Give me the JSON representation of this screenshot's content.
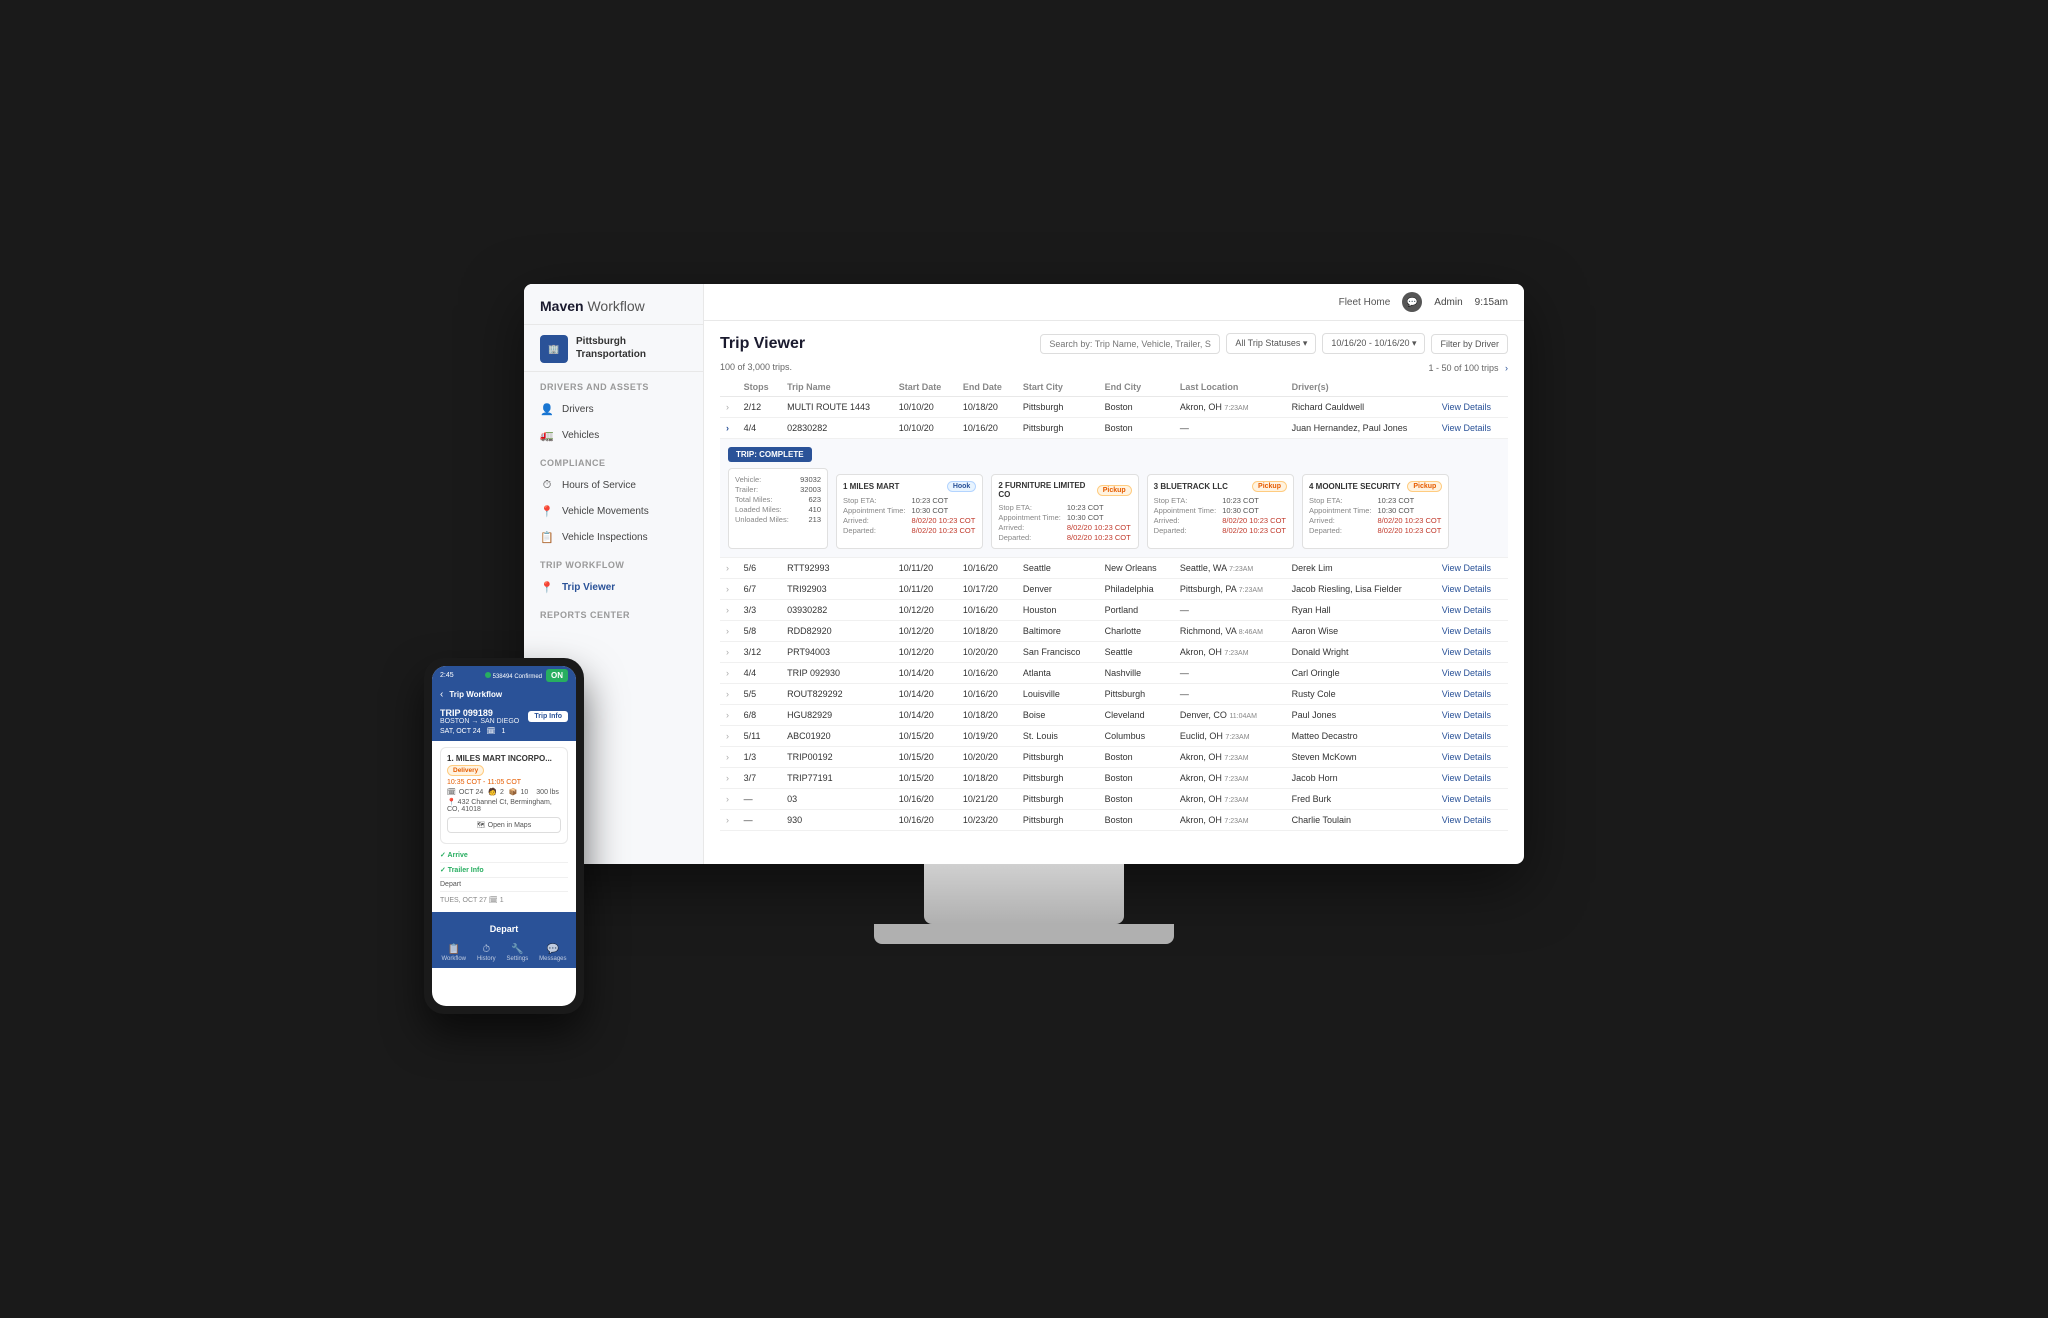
{
  "app": {
    "title": "Maven Workflow",
    "maven": "Maven",
    "workflow": "Workflow",
    "topbar": {
      "fleet_home": "Fleet Home",
      "admin": "Admin",
      "time": "9:15am"
    }
  },
  "sidebar": {
    "company": {
      "name": "Pittsburgh Transportation",
      "icon": "PT"
    },
    "sections": [
      {
        "title": "Drivers and Assets",
        "items": [
          {
            "label": "Drivers",
            "icon": "👤"
          },
          {
            "label": "Vehicles",
            "icon": "🚛"
          }
        ]
      },
      {
        "title": "Compliance",
        "items": [
          {
            "label": "Hours of Service",
            "icon": "⏱"
          },
          {
            "label": "Vehicle Movements",
            "icon": "📍"
          },
          {
            "label": "Vehicle Inspections",
            "icon": "📋"
          }
        ]
      },
      {
        "title": "Trip Workflow",
        "items": [
          {
            "label": "Trip Viewer",
            "icon": "📍",
            "active": true
          }
        ]
      },
      {
        "title": "Reports Center",
        "items": []
      }
    ]
  },
  "trip_viewer": {
    "title": "Trip Viewer",
    "search_placeholder": "Search by: Trip Name, Vehicle, Trailer, Stop Name",
    "status_filter": "All Trip Statuses ▾",
    "date_filter": "10/16/20 - 10/16/20 ▾",
    "driver_filter": "Filter by Driver",
    "total_count": "100 of 3,000 trips.",
    "pagination": "1 - 50 of 100 trips",
    "columns": [
      "Stops",
      "Trip Name",
      "Start Date",
      "End Date",
      "Start City",
      "End City",
      "Last Location",
      "Driver(s)",
      ""
    ],
    "expanded_row": {
      "badge": "TRIP: COMPLETE",
      "vehicle_info": {
        "vehicle": "93032",
        "trailer": "32003",
        "total_miles": "623",
        "loaded_miles": "410",
        "unloaded_miles": "213"
      },
      "stops": [
        {
          "number": "1",
          "name": "MILES MART",
          "badge": "Hook",
          "badge_type": "hook",
          "eta_label": "Stop ETA:",
          "eta_time": "10:23 COT",
          "apt_label": "Appointment Time:",
          "apt_time": "10:30 COT",
          "arrived_label": "Arrived:",
          "arrived_time": "8/02/20 10:23 COT",
          "departed_label": "Departed:",
          "departed_time": "8/02/20 10:23 COT"
        },
        {
          "number": "2",
          "name": "FURNITURE LIMITED CO",
          "badge": "Pickup",
          "badge_type": "pickup",
          "eta_label": "Stop ETA:",
          "eta_time": "10:23 COT",
          "apt_label": "Appointment Time:",
          "apt_time": "10:30 COT",
          "arrived_label": "Arrived:",
          "arrived_time": "8/02/20 10:23 COT",
          "departed_label": "Departed:",
          "departed_time": "8/02/20 10:23 COT"
        },
        {
          "number": "3",
          "name": "BLUETRACK LLC",
          "badge": "Pickup",
          "badge_type": "pickup",
          "eta_label": "Stop ETA:",
          "eta_time": "10:23 COT",
          "apt_label": "Appointment Time:",
          "apt_time": "10:30 COT",
          "arrived_label": "Arrived:",
          "arrived_time": "8/02/20 10:23 COT",
          "departed_label": "Departed:",
          "departed_time": "8/02/20 10:23 COT"
        },
        {
          "number": "4",
          "name": "MOONLITE SECURITY",
          "badge": "Pickup",
          "badge_type": "pickup",
          "eta_label": "Stop ETA:",
          "eta_time": "10:23 COT",
          "apt_label": "Appointment Time:",
          "apt_time": "10:30 COT",
          "arrived_label": "Arrived:",
          "arrived_time": "8/02/20 10:23 COT",
          "departed_label": "Departed:",
          "departed_time": "8/02/20 10:23 COT"
        }
      ]
    },
    "rows": [
      {
        "stops": "2/12",
        "trip": "MULTI ROUTE 1443",
        "start": "10/10/20",
        "end": "10/18/20",
        "start_city": "Pittsburgh",
        "end_city": "Boston",
        "last_loc": "Akron, OH",
        "last_time": "7:23AM",
        "drivers": "Richard Cauldwell"
      },
      {
        "stops": "4/4",
        "trip": "02830282",
        "start": "10/10/20",
        "end": "10/16/20",
        "start_city": "Pittsburgh",
        "end_city": "Boston",
        "last_loc": "—",
        "last_time": "",
        "drivers": "Juan Hernandez, Paul Jones"
      },
      {
        "stops": "5/6",
        "trip": "RTT92993",
        "start": "10/11/20",
        "end": "10/16/20",
        "start_city": "Seattle",
        "end_city": "New Orleans",
        "last_loc": "Seattle, WA",
        "last_time": "7:23AM",
        "drivers": "Derek Lim"
      },
      {
        "stops": "6/7",
        "trip": "TRI92903",
        "start": "10/11/20",
        "end": "10/17/20",
        "start_city": "Denver",
        "end_city": "Philadelphia",
        "last_loc": "Pittsburgh, PA",
        "last_time": "7:23AM",
        "drivers": "Jacob Riesling, Lisa Fielder"
      },
      {
        "stops": "3/3",
        "trip": "03930282",
        "start": "10/12/20",
        "end": "10/16/20",
        "start_city": "Houston",
        "end_city": "Portland",
        "last_loc": "—",
        "last_time": "",
        "drivers": "Ryan Hall"
      },
      {
        "stops": "5/8",
        "trip": "RDD82920",
        "start": "10/12/20",
        "end": "10/18/20",
        "start_city": "Baltimore",
        "end_city": "Charlotte",
        "last_loc": "Richmond, VA",
        "last_time": "8:46AM",
        "drivers": "Aaron Wise"
      },
      {
        "stops": "3/12",
        "trip": "PRT94003",
        "start": "10/12/20",
        "end": "10/20/20",
        "start_city": "San Francisco",
        "end_city": "Seattle",
        "last_loc": "Akron, OH",
        "last_time": "7:23AM",
        "drivers": "Donald Wright"
      },
      {
        "stops": "4/4",
        "trip": "TRIP 092930",
        "start": "10/14/20",
        "end": "10/16/20",
        "start_city": "Atlanta",
        "end_city": "Nashville",
        "last_loc": "—",
        "last_time": "",
        "drivers": "Carl Oringle"
      },
      {
        "stops": "5/5",
        "trip": "ROUT829292",
        "start": "10/14/20",
        "end": "10/16/20",
        "start_city": "Louisville",
        "end_city": "Pittsburgh",
        "last_loc": "—",
        "last_time": "",
        "drivers": "Rusty Cole"
      },
      {
        "stops": "6/8",
        "trip": "HGU82929",
        "start": "10/14/20",
        "end": "10/18/20",
        "start_city": "Boise",
        "end_city": "Cleveland",
        "last_loc": "Denver, CO",
        "last_time": "11:04AM",
        "drivers": "Paul Jones"
      },
      {
        "stops": "5/11",
        "trip": "ABC01920",
        "start": "10/15/20",
        "end": "10/19/20",
        "start_city": "St. Louis",
        "end_city": "Columbus",
        "last_loc": "Euclid, OH",
        "last_time": "7:23AM",
        "drivers": "Matteo Decastro"
      },
      {
        "stops": "1/3",
        "trip": "TRIP00192",
        "start": "10/15/20",
        "end": "10/20/20",
        "start_city": "Pittsburgh",
        "end_city": "Boston",
        "last_loc": "Akron, OH",
        "last_time": "7:23AM",
        "drivers": "Steven McKown"
      },
      {
        "stops": "3/7",
        "trip": "TRIP77191",
        "start": "10/15/20",
        "end": "10/18/20",
        "start_city": "Pittsburgh",
        "end_city": "Boston",
        "last_loc": "Akron, OH",
        "last_time": "7:23AM",
        "drivers": "Jacob Horn"
      },
      {
        "stops": "—",
        "trip": "03",
        "start": "10/16/20",
        "end": "10/21/20",
        "start_city": "Pittsburgh",
        "end_city": "Boston",
        "last_loc": "Akron, OH",
        "last_time": "7:23AM",
        "drivers": "Fred Burk"
      },
      {
        "stops": "—",
        "trip": "930",
        "start": "10/16/20",
        "end": "10/23/20",
        "start_city": "Pittsburgh",
        "end_city": "Boston",
        "last_loc": "Akron, OH",
        "last_time": "7:23AM",
        "drivers": "Charlie Toulain"
      }
    ]
  },
  "phone": {
    "status_bar": {
      "time": "2:45",
      "signal": "▲▲▲",
      "battery": "■■■",
      "id": "538494",
      "status": "Confirmed",
      "on_badge": "ON"
    },
    "nav": {
      "back": "‹",
      "title": "Trip Workflow"
    },
    "trip": {
      "id": "TRIP 099189",
      "route": "BOSTON → SAN DIEGO",
      "date": "SAT, OCT 24",
      "stops": "1",
      "btn": "Trip Info"
    },
    "stop": {
      "number": "1.",
      "name": "MILES MART INCORPO...",
      "badge": "Delivery",
      "time_range": "10:35 COT - 11:05 COT",
      "date": "OCT 24",
      "pallets": "2",
      "pieces": "10",
      "weight": "300 lbs",
      "address": "432 Channel Ct, Bermingham, CO, 41018",
      "map_btn": "Open in Maps"
    },
    "actions": [
      {
        "label": "Arrive",
        "status": "green",
        "time": ""
      },
      {
        "label": "Trailer Info",
        "status": "green",
        "time": ""
      },
      {
        "label": "Depart",
        "status": "normal",
        "time": ""
      }
    ],
    "next_day": {
      "label": "TUES, OCT 27",
      "stops": "1"
    },
    "depart_btn": "Depart",
    "footer_icons": [
      "Workflow",
      "History",
      "Settings",
      "Messages"
    ]
  }
}
